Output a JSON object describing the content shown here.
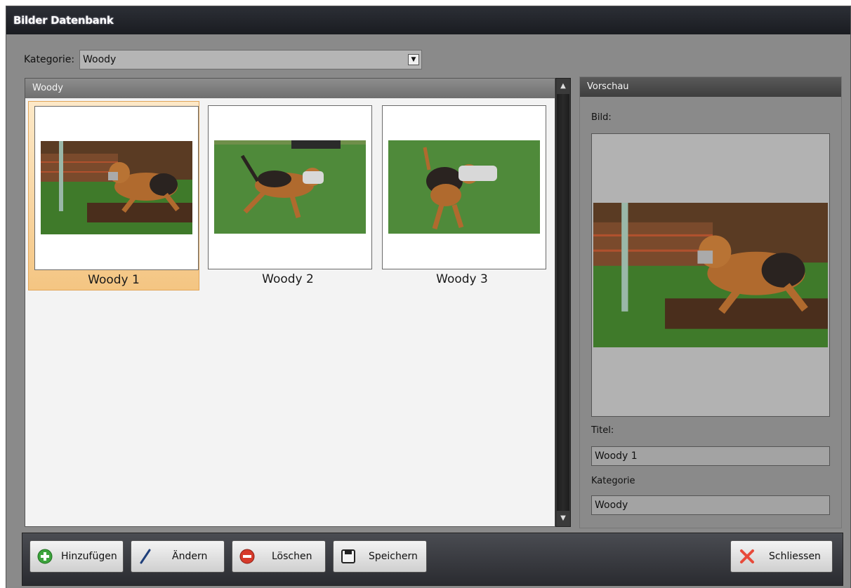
{
  "window": {
    "title": "Bilder Datenbank"
  },
  "category_bar": {
    "label": "Kategorie:",
    "selected": "Woody"
  },
  "gallery": {
    "header": "Woody",
    "items": [
      {
        "caption": "Woody 1",
        "selected": true
      },
      {
        "caption": "Woody 2",
        "selected": false
      },
      {
        "caption": "Woody 3",
        "selected": false
      }
    ]
  },
  "preview": {
    "header": "Vorschau",
    "image_label": "Bild:",
    "title_label": "Titel:",
    "title_value": "Woody 1",
    "category_label": "Kategorie",
    "category_value": "Woody"
  },
  "toolbar": {
    "add_label": "Hinzufügen",
    "edit_label": "Ändern",
    "delete_label": "Löschen",
    "save_label": "Speichern",
    "close_label": "Schliessen"
  },
  "icons": {
    "add": "plus-circle-icon",
    "edit": "pencil-icon",
    "delete": "minus-circle-icon",
    "save": "floppy-disk-icon",
    "close": "x-icon"
  },
  "colors": {
    "selection": "#f4c582",
    "add_green": "#3ca33c",
    "delete_red": "#d63a2b",
    "close_red": "#e84a3a"
  }
}
